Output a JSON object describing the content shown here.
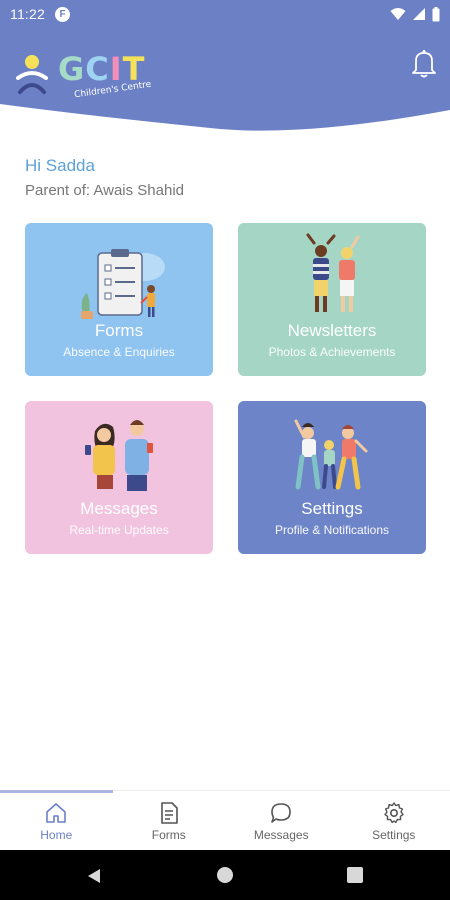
{
  "status_bar": {
    "time": "11:22",
    "app_icon_letter": "F",
    "icons": [
      "wifi-icon",
      "signal-icon",
      "battery-icon"
    ]
  },
  "header": {
    "logo_text": "GCIT",
    "logo_sub": "Children's Centre",
    "bg_color": "#6c80c6",
    "notification_icon": "bell-icon"
  },
  "greeting": {
    "hi": "Hi Sadda",
    "parent": "Parent of: Awais Shahid"
  },
  "cards": [
    {
      "title": "Forms",
      "subtitle": "Absence & Enquiries",
      "color": "#8fc3f0"
    },
    {
      "title": "Newsletters",
      "subtitle": "Photos & Achievements",
      "color": "#a4d5c5"
    },
    {
      "title": "Messages",
      "subtitle": "Real-time Updates",
      "color": "#f2c3df"
    },
    {
      "title": "Settings",
      "subtitle": "Profile & Notifications",
      "color": "#6d84c8"
    }
  ],
  "bottom_nav": {
    "items": [
      {
        "label": "Home",
        "icon": "home-icon",
        "active": true
      },
      {
        "label": "Forms",
        "icon": "document-icon",
        "active": false
      },
      {
        "label": "Messages",
        "icon": "chat-bubble-icon",
        "active": false
      },
      {
        "label": "Settings",
        "icon": "gear-icon",
        "active": false
      }
    ],
    "active_color": "#6c80c6"
  },
  "system_nav": [
    "back-icon",
    "home-circle-icon",
    "recent-apps-icon"
  ]
}
